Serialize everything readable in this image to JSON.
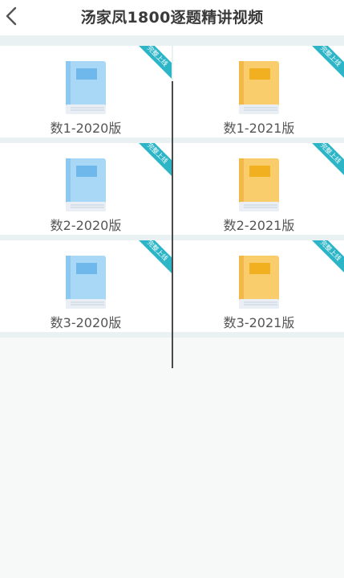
{
  "header": {
    "title": "汤家凤1800逐题精讲视频"
  },
  "ribbon_text": "完整上线",
  "colors": {
    "blue_book": "#a9d8f7",
    "yellow_book": "#f9cd6b",
    "ribbon": "#2bb5c7"
  },
  "items": [
    {
      "label": "数1-2020版",
      "color": "blue"
    },
    {
      "label": "数1-2021版",
      "color": "yellow"
    },
    {
      "label": "数2-2020版",
      "color": "blue"
    },
    {
      "label": "数2-2021版",
      "color": "yellow"
    },
    {
      "label": "数3-2020版",
      "color": "blue"
    },
    {
      "label": "数3-2021版",
      "color": "yellow"
    }
  ]
}
